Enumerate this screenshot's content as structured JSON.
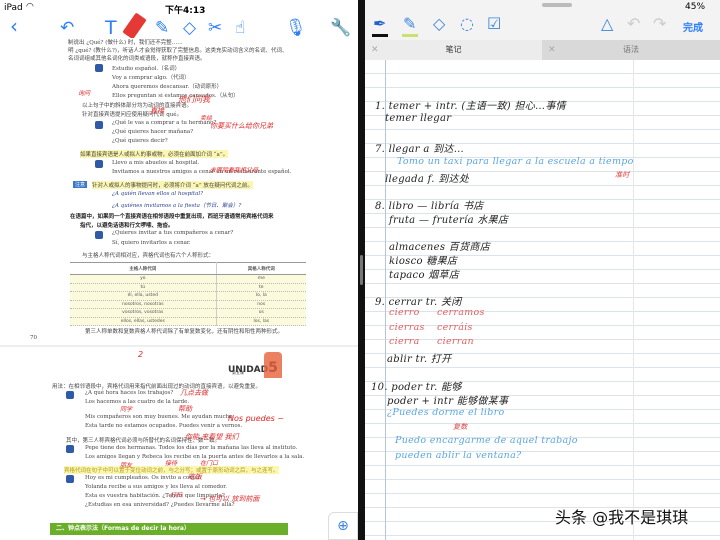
{
  "status": {
    "device": "iPad",
    "time": "下午4:13",
    "battery": "45%"
  },
  "left_toolbar": {
    "icons": [
      "back-icon",
      "undo-icon",
      "text-icon",
      "pen-icon",
      "highlighter-icon",
      "eraser-icon",
      "scissors-icon",
      "hand-icon",
      "microphone-icon",
      "wrench-icon"
    ],
    "active_color": "#e53935"
  },
  "book": {
    "p1": {
      "intro": [
        "制说出 ¿Qué? (做什么) 时，我们还不完整……",
        "明 ¿qué? (教什么?)，听话人才会觉得获取了完整信息。这类充实动词含义的名词、代词、",
        "名词词组或其他名词化的词类或语段，就称作直接宾语。"
      ],
      "ex1": [
        "Estudio español.（名词）",
        "Voy a comprar algo.（代词）",
        "Ahora queremos descansar.（动词原形）",
        "Ellos preguntan si estamos cansados.（从句）"
      ],
      "note1": [
        "以上句子中的斜体部分均为动词的直接宾语。",
        "针对直接宾语提问应使用疑问代词 qué。"
      ],
      "ex2": [
        "¿Qué le vas a comprar a tu hermano?",
        "¿Qué quieres hacer mañana?",
        "¿Qué quieres decir?"
      ],
      "rule_a": "如果直接宾语是人或拟人的事或物，必须在前面加介词 “a”。",
      "ex3": [
        "Llevo a mis abuelos al hospital.",
        "Invitamos a nuestros amigos a cenar en un restaurante español."
      ],
      "note_label": "注意",
      "note2": "针对人或拟人的事物提问时，必须将介词 “a” 放在疑问代词之前。",
      "ex4": [
        "¿A quién llevan ellos al hospital?",
        "¿A quiénes invitamos a la fiesta（节日、聚会）?"
      ],
      "item2": [
        "在语篇中，如果同一个直接宾语在相邻语段中重复出现，西班牙语通常用宾格代词来",
        "指代，以避免话语和行文啰嗦、拖沓。"
      ],
      "ex5": [
        "¿Quieres invitar a tus compañeros a cenar?",
        "Sí, quiero invitarlos a cenar."
      ],
      "table_intro": "与主格人称代词相对应，宾格代词也有六个人称形式：",
      "table": {
        "headers": [
          "主格人称代词",
          "宾格人称代词"
        ],
        "rows": [
          [
            "yo",
            "me"
          ],
          [
            "tú",
            "te"
          ],
          [
            "él, ella, usted",
            "lo, la"
          ],
          [
            "nosotros, nosotras",
            "nos"
          ],
          [
            "vosotros, vosotras",
            "os"
          ],
          [
            "ellos, ellas, ustedes",
            "los, las"
          ]
        ]
      },
      "note3": "第三人称单数和复数宾格人称代词除了有单复数变化，还有阴性和阳性两种形式。",
      "page_number": "70",
      "annotations": [
        "他们问我",
        "直接",
        "卖给",
        "你要买什么给你兄弟",
        "去医院看我祖父母",
        "询问",
        "累吗"
      ]
    },
    "p2": {
      "unit": "UNIDAD",
      "unit_num": "5",
      "unit_cn": "第五课",
      "usage": "用法：在相邻语段中，宾格代词用来指代前面出现过的动词的直接宾语，以避免重复。",
      "ex1": [
        "¿A qué hora haces los trabajos?",
        "Los hacemos a las cuatro de la tarde.",
        "Mis compañeros son muy buenes. Me ayudan mucho.",
        "Esta tarde no estamos ocupados. Puedes venir a vernos."
      ],
      "note": "其中，第三人称宾格代词必须与所替代的名词保持性、数一致。",
      "ex2": [
        "Pepe tiene dos hermanas. Todos los días por la mañana las lleva al instituto.",
        "Los amigos llegan y Rebeca los recibe en la puerta antes de llevarlos a la sala."
      ],
      "rule": "宾格代词在句子中可以置于变位动词之前，与之分写；或置于原形动词之后，与之连写。",
      "ex3": [
        "Hoy es mi cumpleaños. Os invito a comer.",
        "Yolanda recibe a sus amigos y les lleva al comedor.",
        "Esta es vuestra habitación. ¿Tenéis que limpiarla?",
        "¿Estudias en esa universidad? ¿Puedes llevarme allá?"
      ],
      "section": "二、钟点表示法（Formas de decir la hora）",
      "annotations": [
        "几点去做",
        "帮助",
        "同学",
        "Nos puedes ~",
        "你能 来看望 我们",
        "朋友",
        "接待",
        "在门口",
        "吃饭",
        "打扫",
        "→ 也可以 放到前面"
      ],
      "mark": "2"
    }
  },
  "right_toolbar": {
    "icons": [
      "pen-icon",
      "highlighter-icon",
      "eraser-icon",
      "lasso-icon",
      "edit-icon",
      "shapes-icon",
      "undo-icon",
      "redo-icon"
    ],
    "done": "完成",
    "pen_color": "#111111",
    "highlighter_color": "#c7e36b"
  },
  "tabs": [
    {
      "label": "笔记",
      "active": true
    },
    {
      "label": "语法",
      "active": false
    }
  ],
  "notes": {
    "n6": [
      "1. temer + intr. (主语一致) 担心…事情",
      "temer llegar"
    ],
    "n7": [
      "7. llegar a 到达…",
      "Tomo un taxi para llegar a la escuela a tiempo",
      "准时",
      "llegada f. 到达处"
    ],
    "n8": [
      "8. libro — libría 书店",
      "fruta — frutería 水果店",
      "almacenes 百货商店",
      "kiosco 糖果店",
      "tapaco 烟草店"
    ],
    "n9": [
      "9. cerrar tr. 关闭",
      "cierro",
      "cerramos",
      "cierras",
      "cerráis",
      "cierra",
      "cierran",
      "ablir tr. 打开"
    ],
    "n10": [
      "10. poder tr. 能够",
      "poder + intr 能够做某事",
      "¿Puedes dorme el libro",
      "复数",
      "Puedo encargarme de aquel trabajo",
      "pueden ablir la ventana?"
    ]
  },
  "watermark": "头条 @我不是琪琪"
}
